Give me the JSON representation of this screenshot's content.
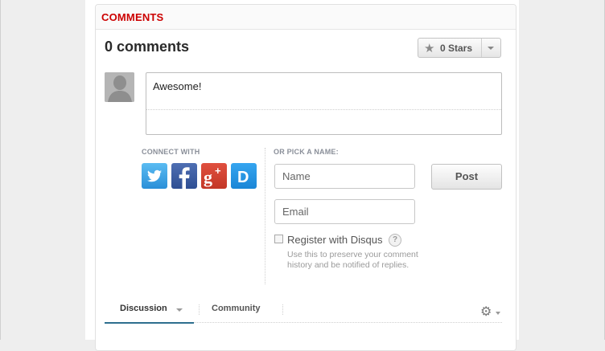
{
  "comments": {
    "section_title": "COMMENTS",
    "count_title": "0 comments",
    "stars_label": "0 Stars",
    "comment_text": "Awesome!",
    "connect_with": "CONNECT WITH",
    "pick_name": "OR PICK A NAME:",
    "social_icons": [
      "twitter-icon",
      "facebook-icon",
      "google-plus-icon",
      "disqus-icon"
    ],
    "name_placeholder": "Name",
    "email_placeholder": "Email",
    "post_label": "Post",
    "register_label": "Register with Disqus",
    "register_help": "Use this to preserve your comment history and be notified of replies.",
    "tabs": [
      {
        "label": "Discussion"
      },
      {
        "label": "Community"
      }
    ]
  },
  "colors": {
    "accent_red": "#cc0000",
    "tab_underline": "#2e6e8e"
  }
}
